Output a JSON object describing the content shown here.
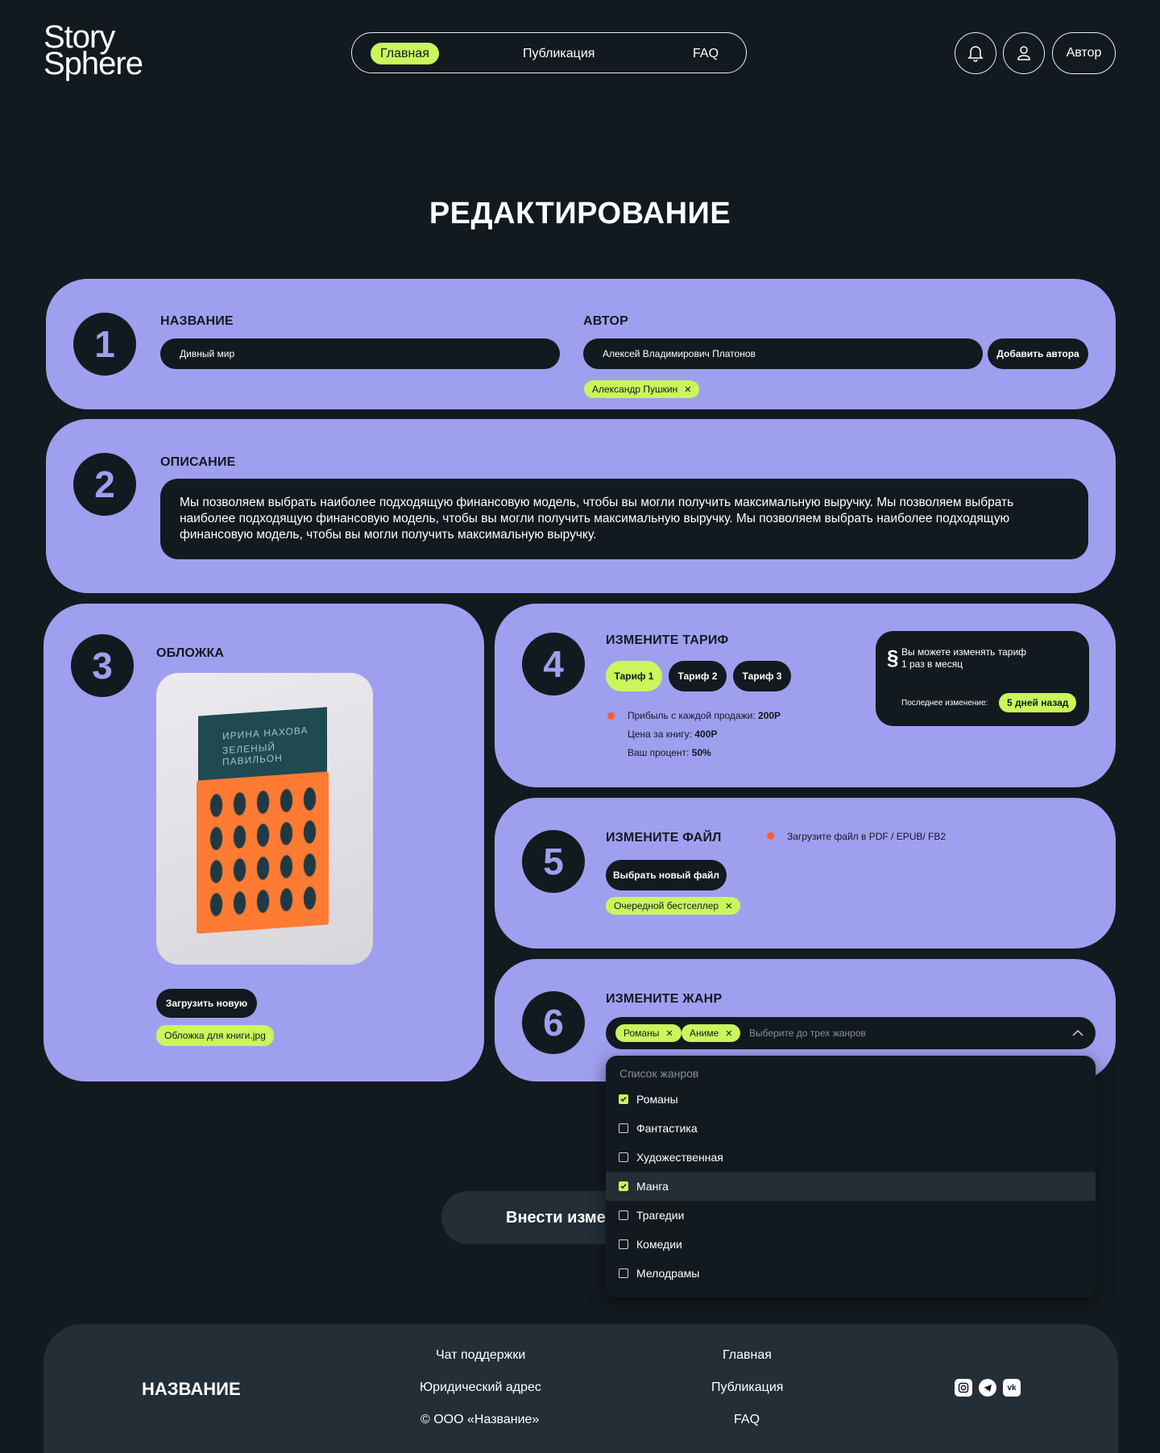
{
  "header": {
    "logo_line1": "Story",
    "logo_line2": "Sphere",
    "nav": [
      "Главная",
      "Публикация",
      "FAQ"
    ],
    "author_button": "Автор",
    "icons": [
      "bell-icon",
      "user-icon"
    ]
  },
  "page_title": "РЕДАКТИРОВАНИЕ",
  "section1": {
    "number": "1",
    "title_label": "НАЗВАНИЕ",
    "title_value": "Дивный мир",
    "author_label": "АВТОР",
    "author_value": "Алексей Владимирович Платонов",
    "add_author": "Добавить автора",
    "author_chip": "Александр Пушкин"
  },
  "section2": {
    "number": "2",
    "label": "ОПИСАНИЕ",
    "text": "Мы позволяем выбрать наиболее подходящую финансовую модель, чтобы вы могли получить максимальную выручку. Мы позволяем выбрать наиболее подходящую финансовую модель, чтобы вы могли получить максимальную выручку. Мы позволяем выбрать наиболее подходящую финансовую модель, чтобы вы могли получить максимальную выручку."
  },
  "section3": {
    "number": "3",
    "label": "ОБЛОЖКА",
    "book_author": "ИРИНА НАХОВА",
    "book_title": "ЗЕЛЕНЫЙ ПАВИЛЬОН",
    "upload": "Загрузить новую",
    "file_chip": "Обложка для книги.jpg"
  },
  "section4": {
    "number": "4",
    "label": "ИЗМЕНИТЕ ТАРИФ",
    "tariffs": [
      "Тариф 1",
      "Тариф 2",
      "Тариф 3"
    ],
    "profit_label": "Прибыль с каждой продажи:",
    "profit_value": "200Р",
    "price_label": "Цена за книгу:",
    "price_value": "400Р",
    "percent_label": "Ваш процент:",
    "percent_value": "50%",
    "note_line1": "Вы можете изменять тариф",
    "note_line2": "1 раз в месяц",
    "last_change_label": "Последнее изменение:",
    "last_change_value": "5 дней назад"
  },
  "section5": {
    "number": "5",
    "label": "ИЗМЕНИТЕ ФАЙЛ",
    "hint": "Загрузите файл в PDF / EPUB/ FB2",
    "choose": "Выбрать новый файл",
    "file_chip": "Очередной бестселлер"
  },
  "section6": {
    "number": "6",
    "label": "ИЗМЕНИТЕ ЖАНР",
    "chips": [
      "Романы",
      "Аниме"
    ],
    "placeholder": "Выберите до трех жанров",
    "list_title": "Список жанров",
    "options": [
      {
        "label": "Романы",
        "checked": true
      },
      {
        "label": "Фантастика",
        "checked": false
      },
      {
        "label": "Художественная",
        "checked": false
      },
      {
        "label": "Манга",
        "checked": true
      },
      {
        "label": "Трагедии",
        "checked": false
      },
      {
        "label": "Комедии",
        "checked": false
      },
      {
        "label": "Мелодрамы",
        "checked": false
      }
    ]
  },
  "submit": "Внести изме",
  "footer": {
    "brand": "НАЗВАНИЕ",
    "col1": [
      "Чат поддержки",
      "Юридический адрес",
      "© ООО «Название»"
    ],
    "col2": [
      "Главная",
      "Публикация",
      "FAQ"
    ],
    "socials": [
      "instagram-icon",
      "telegram-icon",
      "vk-icon"
    ]
  },
  "colors": {
    "bg": "#131a1f",
    "card": "#9f9ff0",
    "accent": "#c9f65b",
    "footer": "#232e37"
  }
}
